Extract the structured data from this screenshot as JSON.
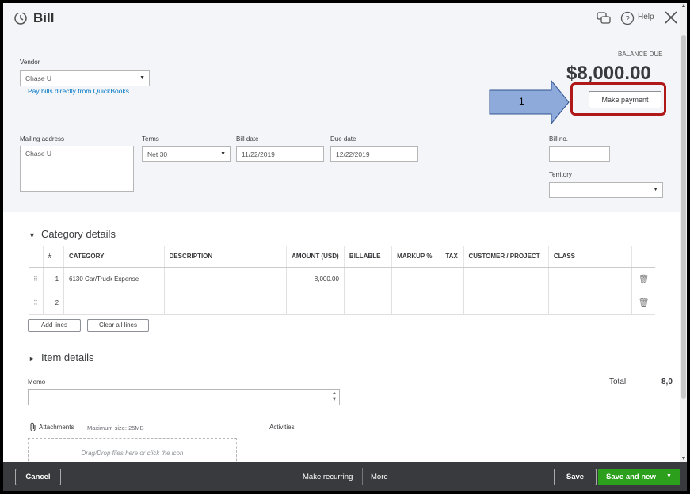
{
  "window": {
    "title": "Bill"
  },
  "header": {
    "help_label": "Help"
  },
  "vendor": {
    "label": "Vendor",
    "value": "Chase U",
    "pay_link": "Pay bills directly from QuickBooks"
  },
  "balance": {
    "label": "BALANCE DUE",
    "amount": "$8,000.00",
    "make_payment": "Make payment"
  },
  "annotation": {
    "step": "1"
  },
  "mailing": {
    "label": "Mailing address",
    "value": "Chase U"
  },
  "terms": {
    "label": "Terms",
    "value": "Net 30"
  },
  "bill_date": {
    "label": "Bill date",
    "value": "11/22/2019"
  },
  "due_date": {
    "label": "Due date",
    "value": "12/22/2019"
  },
  "bill_no": {
    "label": "Bill no.",
    "value": ""
  },
  "territory": {
    "label": "Territory",
    "value": ""
  },
  "category": {
    "title": "Category details",
    "columns": [
      "#",
      "CATEGORY",
      "DESCRIPTION",
      "AMOUNT (USD)",
      "BILLABLE",
      "MARKUP %",
      "TAX",
      "CUSTOMER / PROJECT",
      "CLASS"
    ],
    "rows": [
      {
        "num": "1",
        "category": "6130 Car/Truck Expense",
        "description": "",
        "amount": "8,000.00"
      },
      {
        "num": "2",
        "category": "",
        "description": "",
        "amount": ""
      }
    ],
    "add_lines": "Add lines",
    "clear_lines": "Clear all lines"
  },
  "item": {
    "title": "Item details"
  },
  "memo": {
    "label": "Memo"
  },
  "total": {
    "label": "Total",
    "value": "8,0"
  },
  "attachments": {
    "label": "Attachments",
    "max_size": "Maximum size: 25MB",
    "dropzone": "Drag/Drop files here or click the icon"
  },
  "activities": {
    "label": "Activities"
  },
  "footer": {
    "cancel": "Cancel",
    "make_recurring": "Make recurring",
    "more": "More",
    "save": "Save",
    "save_and_new": "Save and new"
  },
  "colors": {
    "accent": "#0077c5",
    "primary_button": "#2ca01c",
    "annotation_red": "#b01919",
    "arrow_fill": "#8eaadb",
    "footer_bg": "#393a3d"
  }
}
